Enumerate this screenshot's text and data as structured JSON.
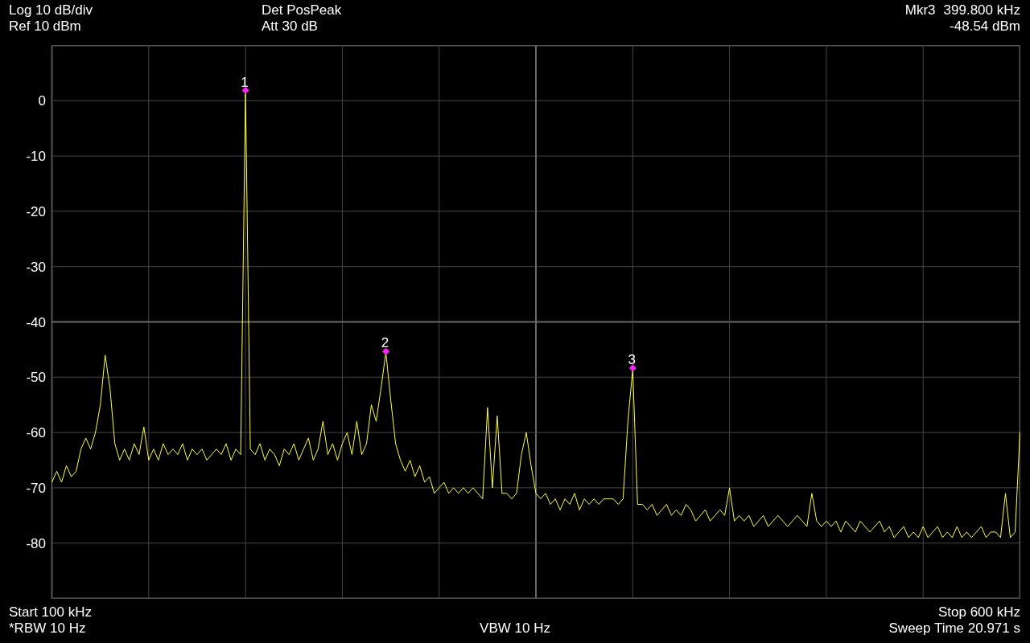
{
  "header": {
    "scale": "Log 10 dB/div",
    "ref_level": "Ref 10 dBm",
    "detector": "Det PosPeak",
    "attenuation": "Att 30 dB",
    "marker_label": "Mkr3",
    "marker_frequency": "399.800 kHz",
    "marker_amplitude": "-48.54 dBm"
  },
  "plot": {
    "chart_data": {
      "type": "line",
      "grid": true,
      "ylim": [
        -90,
        10
      ],
      "yticks": [
        {
          "value": 0,
          "label": "0"
        },
        {
          "value": -10,
          "label": "-10"
        },
        {
          "value": -20,
          "label": "-20"
        },
        {
          "value": -30,
          "label": "-30"
        },
        {
          "value": -40,
          "label": "-40"
        },
        {
          "value": -50,
          "label": "-50"
        },
        {
          "value": -60,
          "label": "-60"
        },
        {
          "value": -70,
          "label": "-70"
        },
        {
          "value": -80,
          "label": "-80"
        }
      ],
      "categories": [
        null,
        null,
        null,
        null,
        null,
        null,
        null,
        null,
        null,
        null,
        null,
        null,
        null,
        null,
        null,
        null,
        null,
        null,
        null,
        null,
        null,
        null,
        null,
        null,
        null,
        null,
        null,
        null,
        null,
        null,
        null,
        null,
        null,
        null,
        null,
        null,
        null,
        null,
        null,
        null,
        null,
        null,
        null,
        null,
        null,
        null,
        null,
        null,
        null,
        null,
        null,
        null,
        null,
        null,
        null,
        null,
        null,
        null,
        null,
        null,
        null,
        null,
        null,
        null,
        null,
        null,
        null,
        null,
        null,
        null,
        null,
        null,
        null,
        null,
        null,
        null,
        null,
        null,
        null,
        null,
        null,
        null,
        null,
        null,
        null,
        null,
        null,
        null,
        null,
        null,
        null,
        null,
        null,
        null,
        null,
        null,
        null,
        null,
        null,
        null,
        null,
        null,
        null,
        null,
        null,
        null,
        null,
        null,
        null,
        null,
        null,
        null,
        null,
        null,
        null,
        null,
        null,
        null,
        null,
        null,
        null,
        null,
        null,
        null,
        null,
        null,
        null,
        null,
        null,
        null,
        null,
        null,
        null,
        null,
        null,
        null,
        null,
        null,
        null,
        null,
        null,
        null,
        null,
        null,
        null,
        null,
        null,
        null,
        null,
        null,
        null,
        null,
        null,
        null,
        null,
        null,
        null,
        null,
        null,
        null,
        null,
        null,
        null,
        null,
        null,
        null,
        null,
        null,
        null,
        null,
        null,
        null,
        null,
        null,
        null,
        null,
        null,
        null,
        null,
        null,
        null,
        null,
        null,
        null,
        null,
        null,
        null,
        null,
        null,
        null,
        null,
        null,
        null,
        null,
        null,
        null,
        null,
        null,
        null,
        null,
        null
      ],
      "series": [
        {
          "color": "#ffff40",
          "values": [
            -69,
            -67,
            -69,
            -66,
            -68,
            -67,
            -63,
            -61,
            -63,
            -60,
            -55,
            -46,
            -52,
            -62,
            -65,
            -63,
            -65,
            -62,
            -64,
            -59,
            -65,
            -63,
            -65,
            -62,
            -64,
            -63,
            -64,
            -62,
            -65,
            -63,
            -64,
            -63,
            -65,
            -64,
            -63,
            -64,
            -62,
            -65,
            -63,
            -64,
            1.7,
            -63,
            -64,
            -62,
            -65,
            -63,
            -64,
            -66,
            -63,
            -64,
            -62,
            -65,
            -63,
            -61,
            -65,
            -63,
            -58,
            -64,
            -62,
            -65,
            -62,
            -60,
            -64,
            -58,
            -64,
            -62,
            -55,
            -58,
            -52,
            -45.5,
            -54,
            -62,
            -65,
            -67,
            -65,
            -68,
            -66,
            -69,
            -68,
            -71,
            -70,
            -69,
            -71,
            -70,
            -71,
            -70,
            -71,
            -70,
            -71,
            -72,
            -55.5,
            -70,
            -57,
            -71,
            -71,
            -72,
            -71,
            -64,
            -60,
            -66,
            -71,
            -72,
            -71,
            -73,
            -72,
            -74,
            -72,
            -73,
            -71,
            -74,
            -72,
            -73,
            -72,
            -73,
            -72,
            -72,
            -72,
            -73,
            -72,
            -58,
            -48.5,
            -73,
            -73,
            -74,
            -73,
            -75,
            -74,
            -73,
            -75,
            -74,
            -75,
            -73,
            -74,
            -76,
            -75,
            -74,
            -76,
            -75,
            -74,
            -75,
            -70,
            -76,
            -75,
            -76,
            -75,
            -77,
            -76,
            -75,
            -77,
            -76,
            -75,
            -76,
            -77,
            -76,
            -75,
            -76,
            -77,
            -71,
            -76,
            -77,
            -76,
            -77,
            -76,
            -78,
            -76,
            -77,
            -78,
            -76,
            -77,
            -78,
            -77,
            -76,
            -78,
            -77,
            -79,
            -78,
            -77,
            -79,
            -78,
            -79,
            -77,
            -79,
            -78,
            -77,
            -79,
            -78,
            -79,
            -77,
            -79,
            -78,
            -79,
            -78,
            -77,
            -79,
            -78,
            -78,
            -79,
            -71,
            -79,
            -78,
            -60
          ]
        }
      ]
    }
  },
  "markers": [
    {
      "label": "1"
    },
    {
      "label": "2"
    },
    {
      "label": "3"
    }
  ],
  "footer": {
    "start": "Start 100 kHz",
    "rbw": "*RBW 10 Hz",
    "vbw": "VBW 10 Hz",
    "stop": "Stop 600 kHz",
    "sweep_time": "Sweep Time 20.971 s"
  }
}
